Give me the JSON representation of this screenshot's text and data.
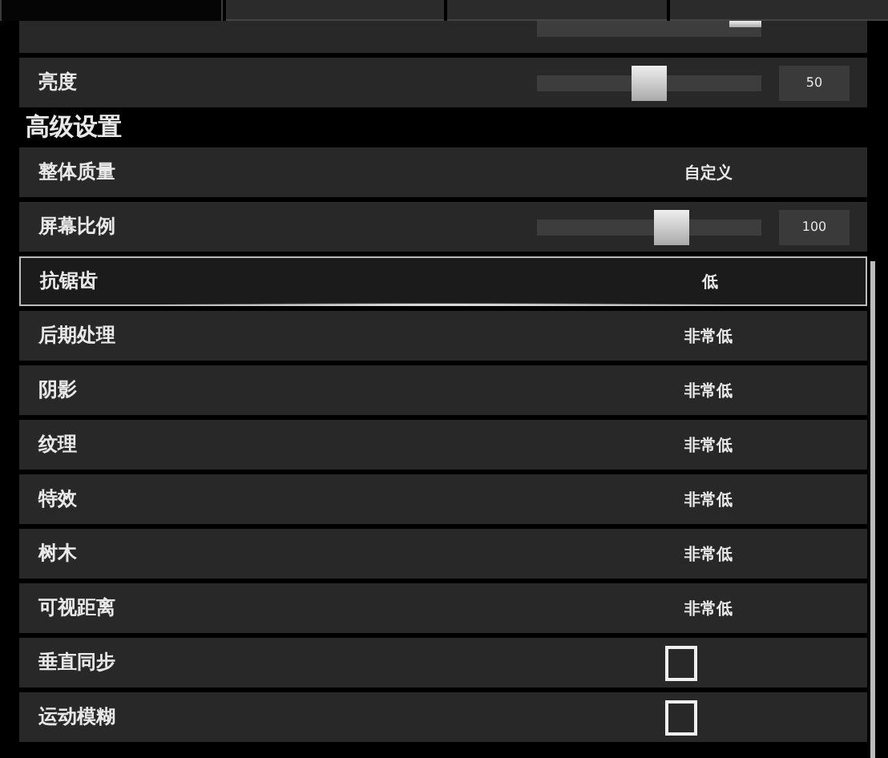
{
  "tabs": [
    {
      "selected": true
    },
    {
      "selected": false
    },
    {
      "selected": false
    },
    {
      "selected": false
    }
  ],
  "top_row": {
    "level": 0.93
  },
  "basic_rows": [
    {
      "kind": "slider",
      "label": "亮度",
      "level": 0.5,
      "reading": "50",
      "selected": false
    }
  ],
  "section_title": "高级设置",
  "advanced_rows": [
    {
      "kind": "value",
      "label": "整体质量",
      "value": "自定义",
      "selected": false
    },
    {
      "kind": "slider",
      "label": "屏幕比例",
      "level": 0.6,
      "reading": "100",
      "selected": false
    },
    {
      "kind": "value",
      "label": "抗锯齿",
      "value": "低",
      "selected": true
    },
    {
      "kind": "value",
      "label": "后期处理",
      "value": "非常低",
      "selected": false
    },
    {
      "kind": "value",
      "label": "阴影",
      "value": "非常低",
      "selected": false
    },
    {
      "kind": "value",
      "label": "纹理",
      "value": "非常低",
      "selected": false
    },
    {
      "kind": "value",
      "label": "特效",
      "value": "非常低",
      "selected": false
    },
    {
      "kind": "value",
      "label": "树木",
      "value": "非常低",
      "selected": false
    },
    {
      "kind": "value",
      "label": "可视距离",
      "value": "非常低",
      "selected": false
    },
    {
      "kind": "checkbox",
      "label": "垂直同步",
      "checked": false,
      "selected": false
    },
    {
      "kind": "checkbox",
      "label": "运动模糊",
      "checked": false,
      "selected": false
    }
  ]
}
